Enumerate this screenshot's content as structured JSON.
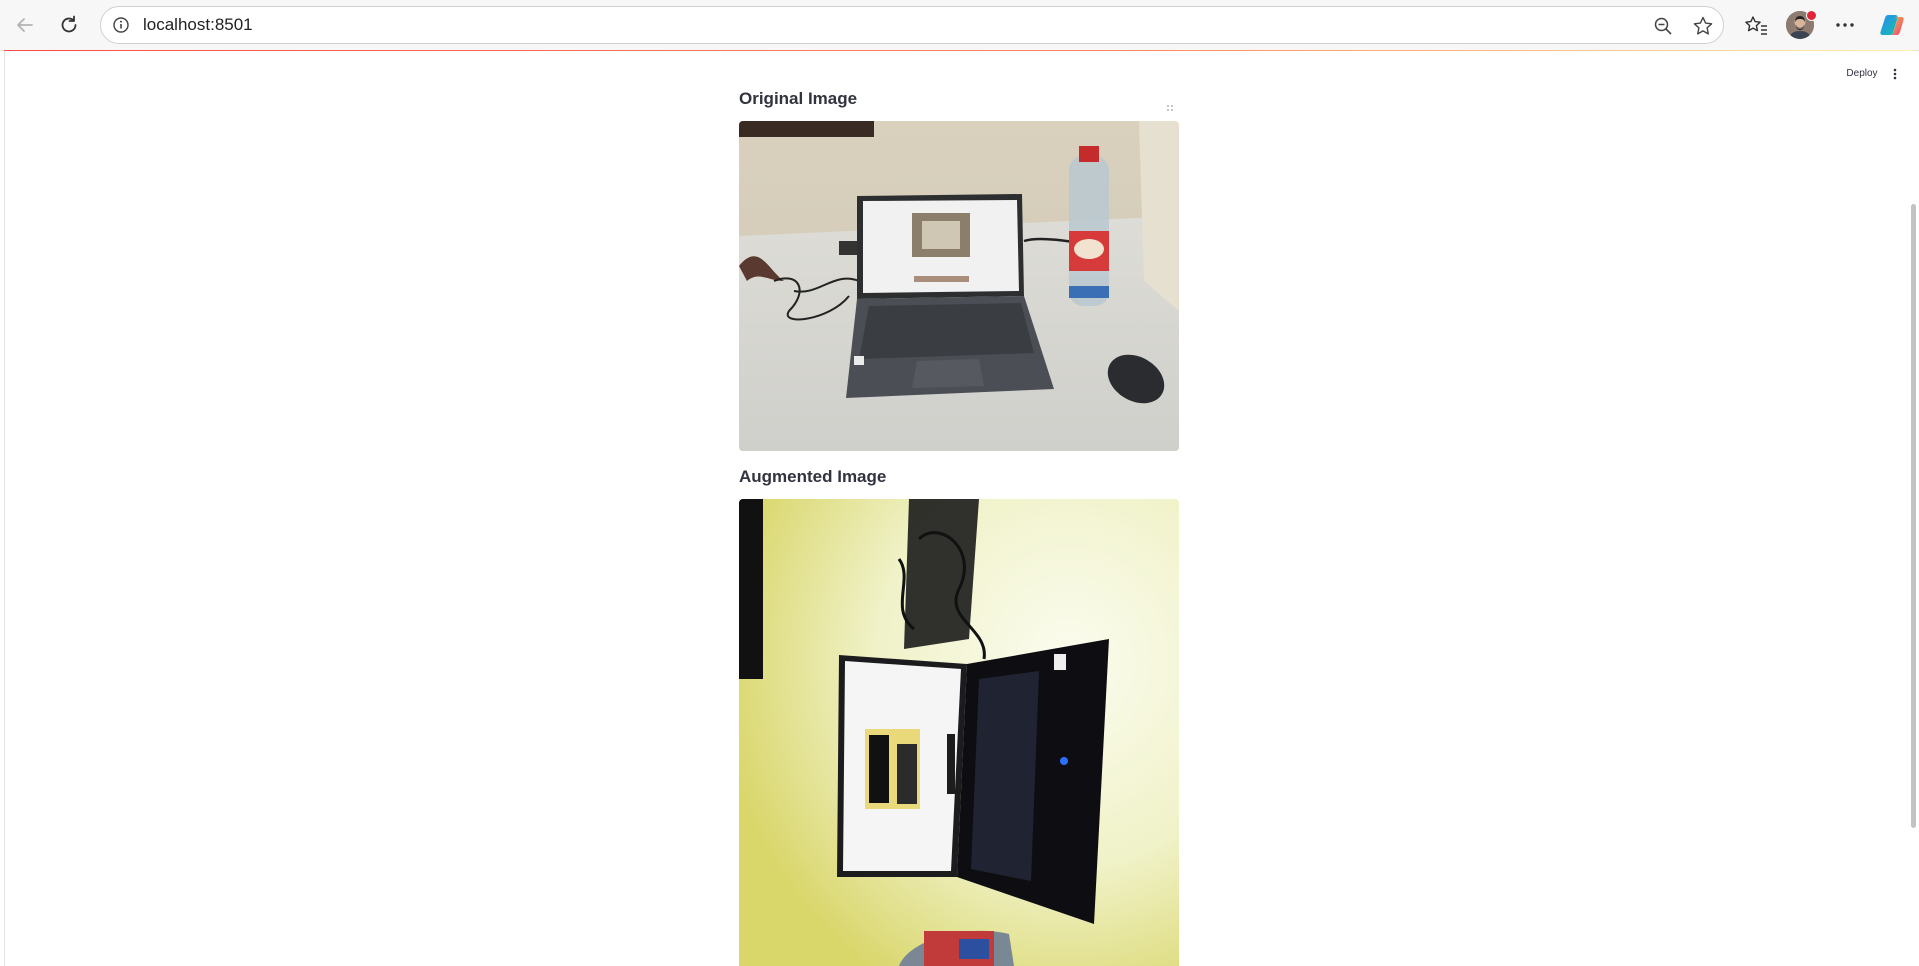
{
  "browser": {
    "url": "localhost:8501",
    "icons": [
      "back-arrow-icon",
      "reload-icon",
      "info-icon",
      "zoom-out-icon",
      "star-icon",
      "favorites-icon",
      "more-icon",
      "copilot-icon"
    ]
  },
  "app": {
    "deploy_label": "Deploy",
    "original_title": "Original Image",
    "augmented_title": "Augmented Image",
    "accent_color": "#ff4b4b"
  }
}
